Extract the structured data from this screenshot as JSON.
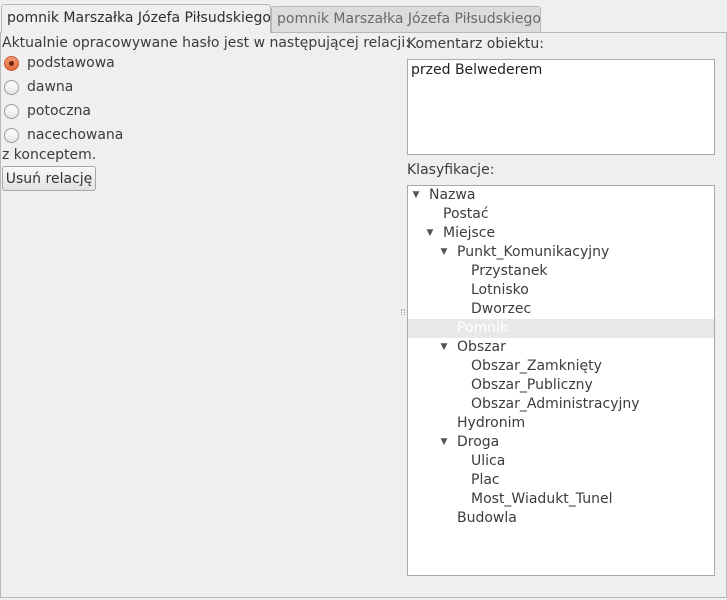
{
  "tabs": [
    {
      "label": "pomnik Marszałka Józefa Piłsudskiego",
      "active": true
    },
    {
      "label": "pomnik Marszałka Józefa Piłsudskiego",
      "active": false
    }
  ],
  "relation": {
    "label": "Aktualnie opracowywane hasło jest w następującej relacji:",
    "options": [
      {
        "label": "podstawowa",
        "checked": true
      },
      {
        "label": "dawna",
        "checked": false
      },
      {
        "label": "potoczna",
        "checked": false
      },
      {
        "label": "nacechowana",
        "checked": false
      }
    ],
    "concept_label": "z konceptem.",
    "remove_button": "Usuń relację"
  },
  "comment": {
    "label": "Komentarz obiektu:",
    "value": "przed Belwederem"
  },
  "classification": {
    "label": "Klasyfikacje:",
    "tree": [
      {
        "label": "Nazwa",
        "level": 0,
        "expanded": true,
        "has_children": true
      },
      {
        "label": "Postać",
        "level": 1,
        "has_children": false
      },
      {
        "label": "Miejsce",
        "level": 1,
        "expanded": true,
        "has_children": true
      },
      {
        "label": "Punkt_Komunikacyjny",
        "level": 2,
        "expanded": true,
        "has_children": true
      },
      {
        "label": "Przystanek",
        "level": 3,
        "has_children": false
      },
      {
        "label": "Lotnisko",
        "level": 3,
        "has_children": false
      },
      {
        "label": "Dworzec",
        "level": 3,
        "has_children": false
      },
      {
        "label": "Pomnik",
        "level": 2,
        "has_children": false,
        "selected": true
      },
      {
        "label": "Obszar",
        "level": 2,
        "expanded": true,
        "has_children": true
      },
      {
        "label": "Obszar_Zamknięty",
        "level": 3,
        "has_children": false
      },
      {
        "label": "Obszar_Publiczny",
        "level": 3,
        "has_children": false
      },
      {
        "label": "Obszar_Administracyjny",
        "level": 3,
        "has_children": false
      },
      {
        "label": "Hydronim",
        "level": 2,
        "has_children": false
      },
      {
        "label": "Droga",
        "level": 2,
        "expanded": true,
        "has_children": true
      },
      {
        "label": "Ulica",
        "level": 3,
        "has_children": false
      },
      {
        "label": "Plac",
        "level": 3,
        "has_children": false
      },
      {
        "label": "Most_Wiadukt_Tunel",
        "level": 3,
        "has_children": false
      },
      {
        "label": "Budowla",
        "level": 2,
        "has_children": false
      }
    ]
  },
  "colors": {
    "window_bg": "#efefef",
    "radio_checked": "#e0683c",
    "selection_bg": "#e8e8e8"
  }
}
